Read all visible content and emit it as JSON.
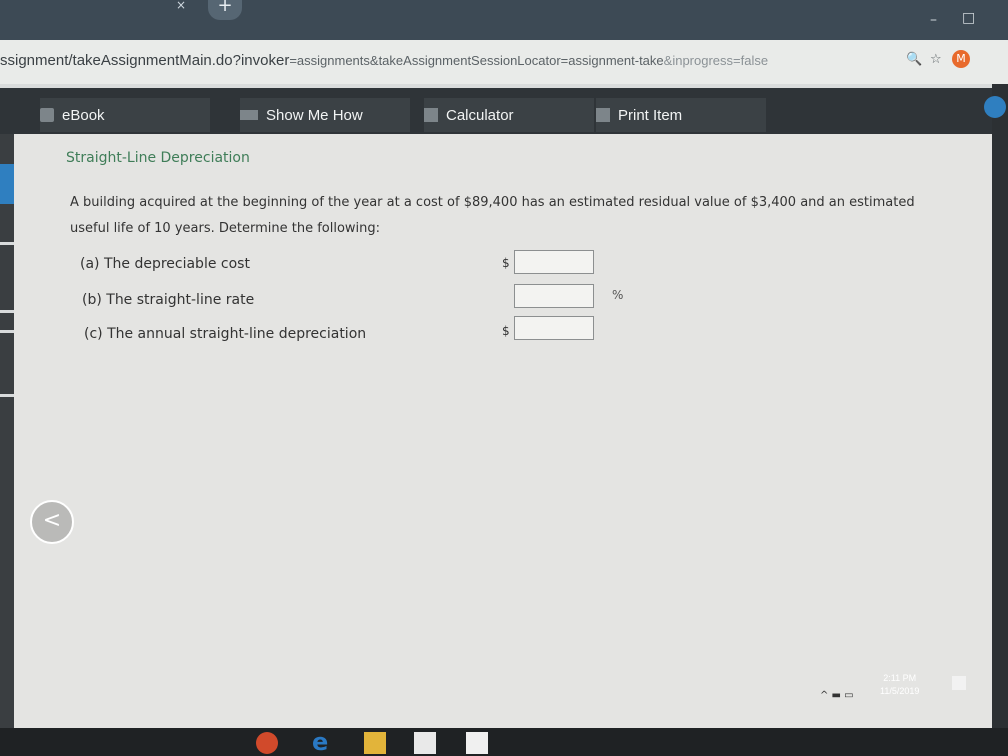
{
  "browser": {
    "url_host": "ssignment/takeAssignmentMain.do?invoker",
    "url_rest": "=assignments&takeAssignmentSessionLocator=assignment-take",
    "url_tail": "&inprogress=false",
    "new_tab": "+",
    "tab_close": "×",
    "window_minimize": "–",
    "window_maximize": "□",
    "zoom_icon": "🔍",
    "star_icon": "☆",
    "extension_icon": "M"
  },
  "toolbar": {
    "ebook": "eBook",
    "show_me_how": "Show Me How",
    "calculator": "Calculator",
    "print_item": "Print Item"
  },
  "problem": {
    "title": "Straight-Line Depreciation",
    "question": "A building acquired at the beginning of the year at a cost of $89,400 has an estimated residual value of $3,400 and an estimated useful life of 10 years. Determine the following:",
    "items": [
      {
        "label": "(a)  The depreciable cost",
        "prefix": "$",
        "suffix": "",
        "value": ""
      },
      {
        "label": "(b)  The straight-line rate",
        "prefix": "",
        "suffix": "%",
        "value": ""
      },
      {
        "label": "(c)  The annual straight-line depreciation",
        "prefix": "$",
        "suffix": "",
        "value": ""
      }
    ]
  },
  "navigation": {
    "back": "<"
  },
  "system": {
    "time": "2:11 PM",
    "date": "11/5/2019"
  },
  "colors": {
    "title_green": "#3f7d58",
    "toolbar_bg": "#2f3438",
    "content_bg": "#e4e4e2"
  }
}
